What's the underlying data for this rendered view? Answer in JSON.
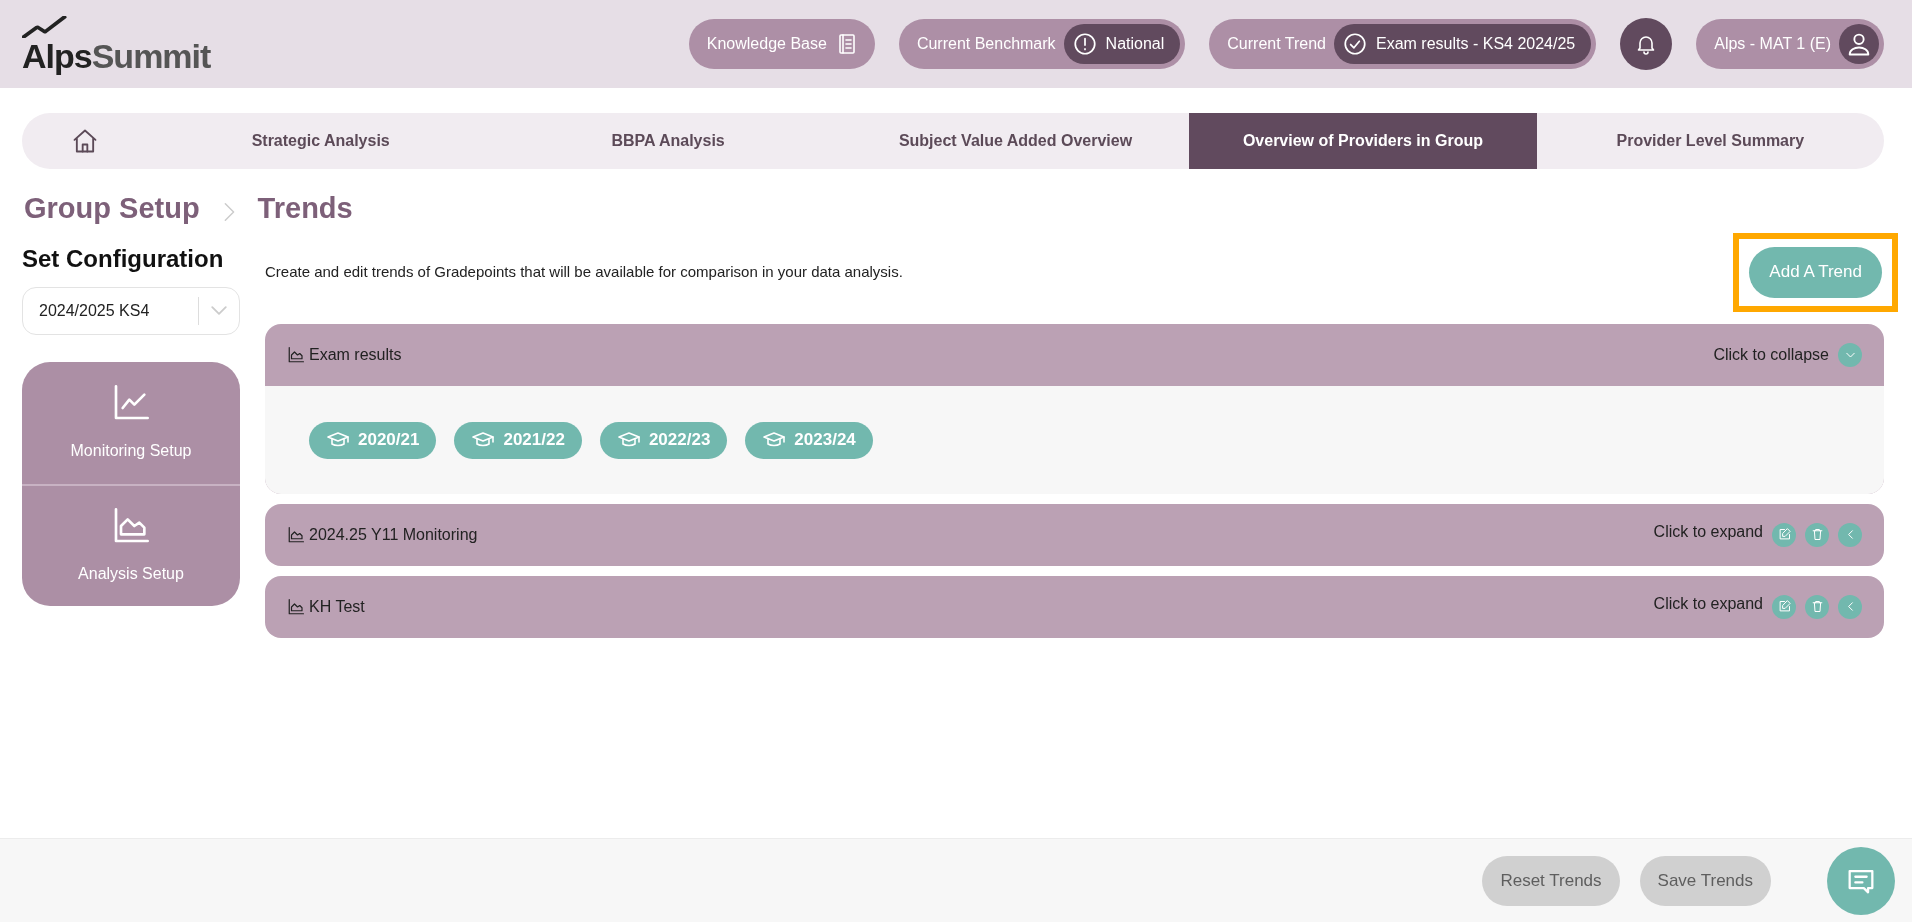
{
  "header": {
    "logo": {
      "word_1": "Alps",
      "word_2": "Summit"
    },
    "pills": [
      {
        "kind": "link",
        "label": "Knowledge Base"
      },
      {
        "kind": "benchmark",
        "label": "Current Benchmark",
        "value": "National"
      },
      {
        "kind": "trend",
        "label": "Current Trend",
        "value": "Exam results - KS4 2024/25"
      }
    ],
    "user": {
      "label": "Alps - MAT 1 (E)"
    }
  },
  "nav_tabs": [
    {
      "kind": "home",
      "selected": false
    },
    {
      "kind": "text",
      "label": "Strategic Analysis",
      "selected": false
    },
    {
      "kind": "text",
      "label": "BBPA Analysis",
      "selected": false
    },
    {
      "kind": "text",
      "label": "Subject Value Added Overview",
      "selected": false
    },
    {
      "kind": "text",
      "label": "Overview of Providers in Group",
      "selected": true
    },
    {
      "kind": "text",
      "label": "Provider Level Summary",
      "selected": false
    }
  ],
  "breadcrumb": [
    "Group Setup",
    "Trends"
  ],
  "sidebar": {
    "title": "Set Configuration",
    "select_value": "2024/2025 KS4",
    "items": [
      {
        "kind": "line",
        "label": "Monitoring Setup"
      },
      {
        "kind": "area",
        "label": "Analysis Setup"
      }
    ]
  },
  "description": "Create and edit trends of Gradepoints that will be available for comparison in your data analysis.",
  "add_button": {
    "label": "Add A Trend",
    "highlighted": true
  },
  "trends": [
    {
      "name": "Exam results",
      "expanded": true,
      "toggle_text": "Click to collapse",
      "years": [
        "2020/21",
        "2021/22",
        "2022/23",
        "2023/24"
      ]
    },
    {
      "name": "2024.25 Y11 Monitoring",
      "expanded": false,
      "toggle_text": "Click to expand"
    },
    {
      "name": "KH Test",
      "expanded": false,
      "toggle_text": "Click to expand"
    }
  ],
  "footer": {
    "buttons": [
      {
        "label": "Reset Trends",
        "disabled": true
      },
      {
        "label": "Save Trends",
        "disabled": true
      }
    ]
  }
}
